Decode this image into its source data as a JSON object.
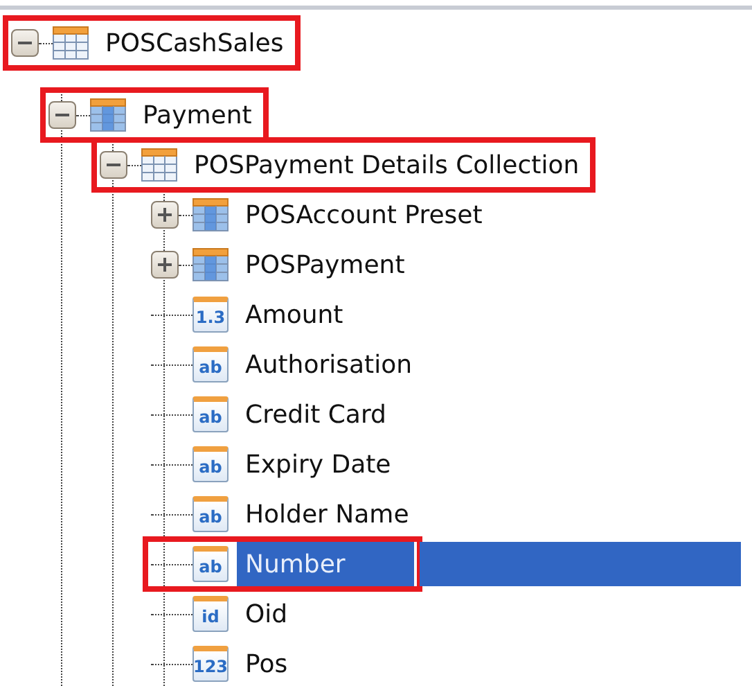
{
  "tree": [
    {
      "label": "POSCashSales",
      "kind": "table",
      "expanded": true,
      "highlighted": true,
      "selected": false,
      "children": [
        {
          "label": "Payment",
          "kind": "collection",
          "expanded": true,
          "highlighted": true,
          "selected": false,
          "children": [
            {
              "label": "POSPayment Details Collection",
              "kind": "table",
              "expanded": true,
              "highlighted": true,
              "selected": false,
              "children": [
                {
                  "label": "POSAccount Preset",
                  "kind": "collection",
                  "expanded": false,
                  "highlighted": false,
                  "selected": false
                },
                {
                  "label": "POSPayment",
                  "kind": "collection",
                  "expanded": false,
                  "highlighted": false,
                  "selected": false
                },
                {
                  "label": "Amount",
                  "kind": "field",
                  "glyph": "1.3",
                  "highlighted": false,
                  "selected": false
                },
                {
                  "label": "Authorisation",
                  "kind": "field",
                  "glyph": "ab",
                  "highlighted": false,
                  "selected": false
                },
                {
                  "label": "Credit Card",
                  "kind": "field",
                  "glyph": "ab",
                  "highlighted": false,
                  "selected": false
                },
                {
                  "label": "Expiry Date",
                  "kind": "field",
                  "glyph": "ab",
                  "highlighted": false,
                  "selected": false
                },
                {
                  "label": "Holder Name",
                  "kind": "field",
                  "glyph": "ab",
                  "highlighted": false,
                  "selected": false
                },
                {
                  "label": "Number",
                  "kind": "field",
                  "glyph": "ab",
                  "highlighted": true,
                  "selected": true
                },
                {
                  "label": "Oid",
                  "kind": "field",
                  "glyph": "id",
                  "highlighted": false,
                  "selected": false
                },
                {
                  "label": "Pos",
                  "kind": "field",
                  "glyph": "123",
                  "highlighted": false,
                  "selected": false
                }
              ]
            }
          ]
        }
      ]
    }
  ]
}
